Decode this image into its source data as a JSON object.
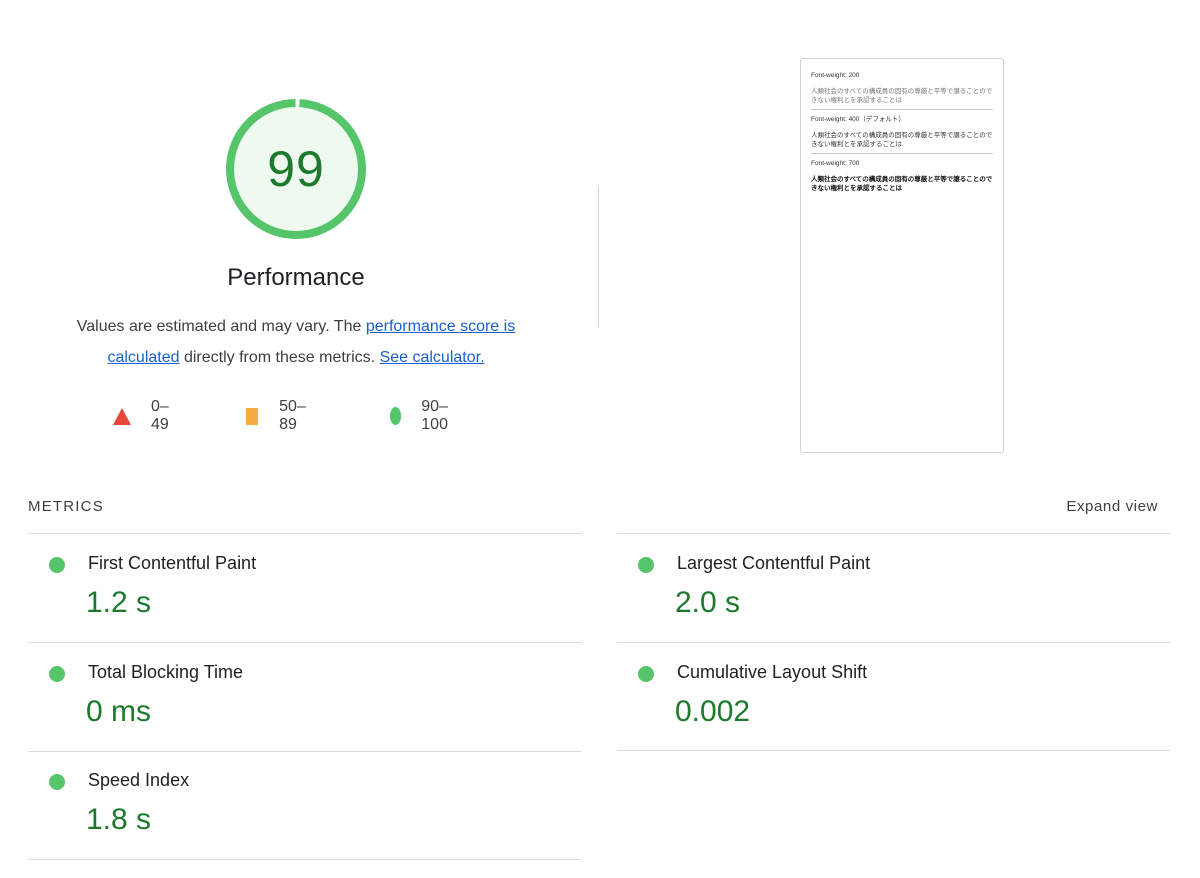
{
  "score": {
    "value": "99",
    "numeric": 99,
    "color": "#1d7a2c",
    "ring_color": "#56c56a",
    "fill_color": "#eefaf0"
  },
  "category": {
    "title": "Performance"
  },
  "description": {
    "text1": "Values are estimated and may vary. The ",
    "link1": "performance score is calculated",
    "text2": " directly from these metrics. ",
    "link2": "See calculator."
  },
  "legend": [
    {
      "icon": "triangle-icon",
      "label": "0–49",
      "color": "#e8483b"
    },
    {
      "icon": "square-icon",
      "label": "50–89",
      "color": "#f6ad3e"
    },
    {
      "icon": "circle-icon",
      "label": "90–100",
      "color": "#56c56a"
    }
  ],
  "screenshot": {
    "sections": [
      {
        "label": "Font-weight: 200",
        "text": "人類社会のすべての構成員の固有の尊厳と平等で譲ることのできない権利とを承認することは"
      },
      {
        "label": "Font-weight: 400（デフォルト）",
        "text": "人類社会のすべての構成員の固有の尊厳と平等で譲ることのできない権利とを承認することは"
      },
      {
        "label": "Font-weight: 700",
        "text": "人類社会のすべての構成員の固有の尊厳と平等で譲ることのできない権利とを承認することは"
      }
    ]
  },
  "metrics": {
    "header": "METRICS",
    "expand_label": "Expand view",
    "items": [
      {
        "name": "First Contentful Paint",
        "value": "1.2 s"
      },
      {
        "name": "Largest Contentful Paint",
        "value": "2.0 s"
      },
      {
        "name": "Total Blocking Time",
        "value": "0 ms"
      },
      {
        "name": "Cumulative Layout Shift",
        "value": "0.002"
      },
      {
        "name": "Speed Index",
        "value": "1.8 s"
      }
    ]
  }
}
